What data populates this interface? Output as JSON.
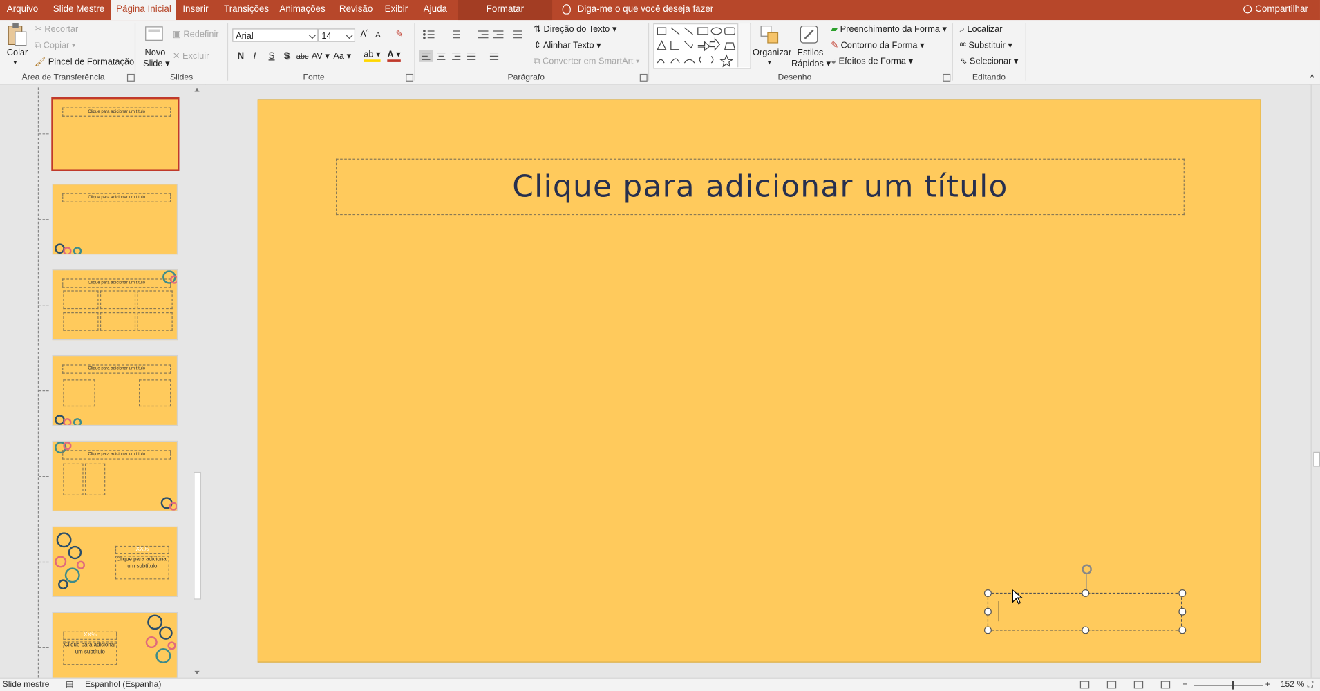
{
  "tabs": [
    {
      "label": "Arquivo"
    },
    {
      "label": "Slide Mestre"
    },
    {
      "label": "Página Inicial"
    },
    {
      "label": "Inserir"
    },
    {
      "label": "Transições"
    },
    {
      "label": "Animações"
    },
    {
      "label": "Revisão"
    },
    {
      "label": "Exibir"
    },
    {
      "label": "Ajuda"
    },
    {
      "label": "Formatar"
    }
  ],
  "tell_me": "Diga-me o que você deseja fazer",
  "share": "Compartilhar",
  "clipboard": {
    "paste": "Colar",
    "cut": "Recortar",
    "copy": "Copiar",
    "format_painter": "Pincel de Formatação",
    "label": "Área de Transferência"
  },
  "slides_group": {
    "new_slide_1": "Novo",
    "new_slide_2": "Slide",
    "reset": "Redefinir",
    "delete": "Excluir",
    "label": "Slides"
  },
  "font": {
    "name": "Arial",
    "size": "14",
    "label": "Fonte",
    "bold": "N",
    "italic": "I",
    "underline": "S",
    "shadow": "S",
    "strike": "abc",
    "spacing": "AV",
    "case": "Aa",
    "color_letter": "A"
  },
  "paragraph": {
    "text_direction": "Direção do Texto",
    "align_text": "Alinhar Texto",
    "smartart": "Converter em SmartArt",
    "label": "Parágrafo"
  },
  "drawing": {
    "arrange": "Organizar",
    "quick_styles_1": "Estilos",
    "quick_styles_2": "Rápidos",
    "shape_fill": "Preenchimento da Forma",
    "shape_outline": "Contorno da Forma",
    "shape_effects": "Efeitos de Forma",
    "label": "Desenho"
  },
  "editing": {
    "find": "Localizar",
    "replace": "Substituir",
    "select": "Selecionar",
    "label": "Editando"
  },
  "thumbnails": {
    "title_text": "Clique para adicionar um título",
    "subtitle_text": "Clique para adicionar um subtítulo",
    "xx": "XX%"
  },
  "slide": {
    "title": "Clique para adicionar um título"
  },
  "status": {
    "view": "Slide mestre",
    "language": "Espanhol (Espanha)",
    "zoom": "152 %"
  },
  "colors": {
    "accent": "#b7472a",
    "slide_bg": "#ffca5c",
    "title_text": "#27304f"
  }
}
